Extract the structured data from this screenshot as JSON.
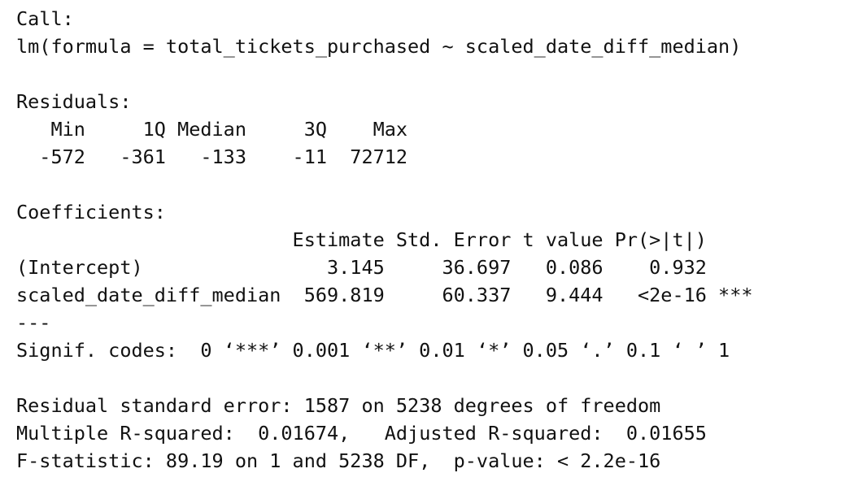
{
  "lines": [
    "Call:",
    "lm(formula = total_tickets_purchased ~ scaled_date_diff_median)",
    "",
    "Residuals:",
    "   Min     1Q Median     3Q    Max ",
    "  -572   -361   -133    -11  72712 ",
    "",
    "Coefficients:",
    "                        Estimate Std. Error t value Pr(>|t|)    ",
    "(Intercept)                3.145     36.697   0.086    0.932    ",
    "scaled_date_diff_median  569.819     60.337   9.444   <2e-16 ***",
    "---",
    "Signif. codes:  0 ‘***’ 0.001 ‘**’ 0.01 ‘*’ 0.05 ‘.’ 0.1 ‘ ’ 1",
    "",
    "Residual standard error: 1587 on 5238 degrees of freedom",
    "Multiple R-squared:  0.01674,\tAdjusted R-squared:  0.01655 ",
    "F-statistic: 89.19 on 1 and 5238 DF,  p-value: < 2.2e-16"
  ]
}
